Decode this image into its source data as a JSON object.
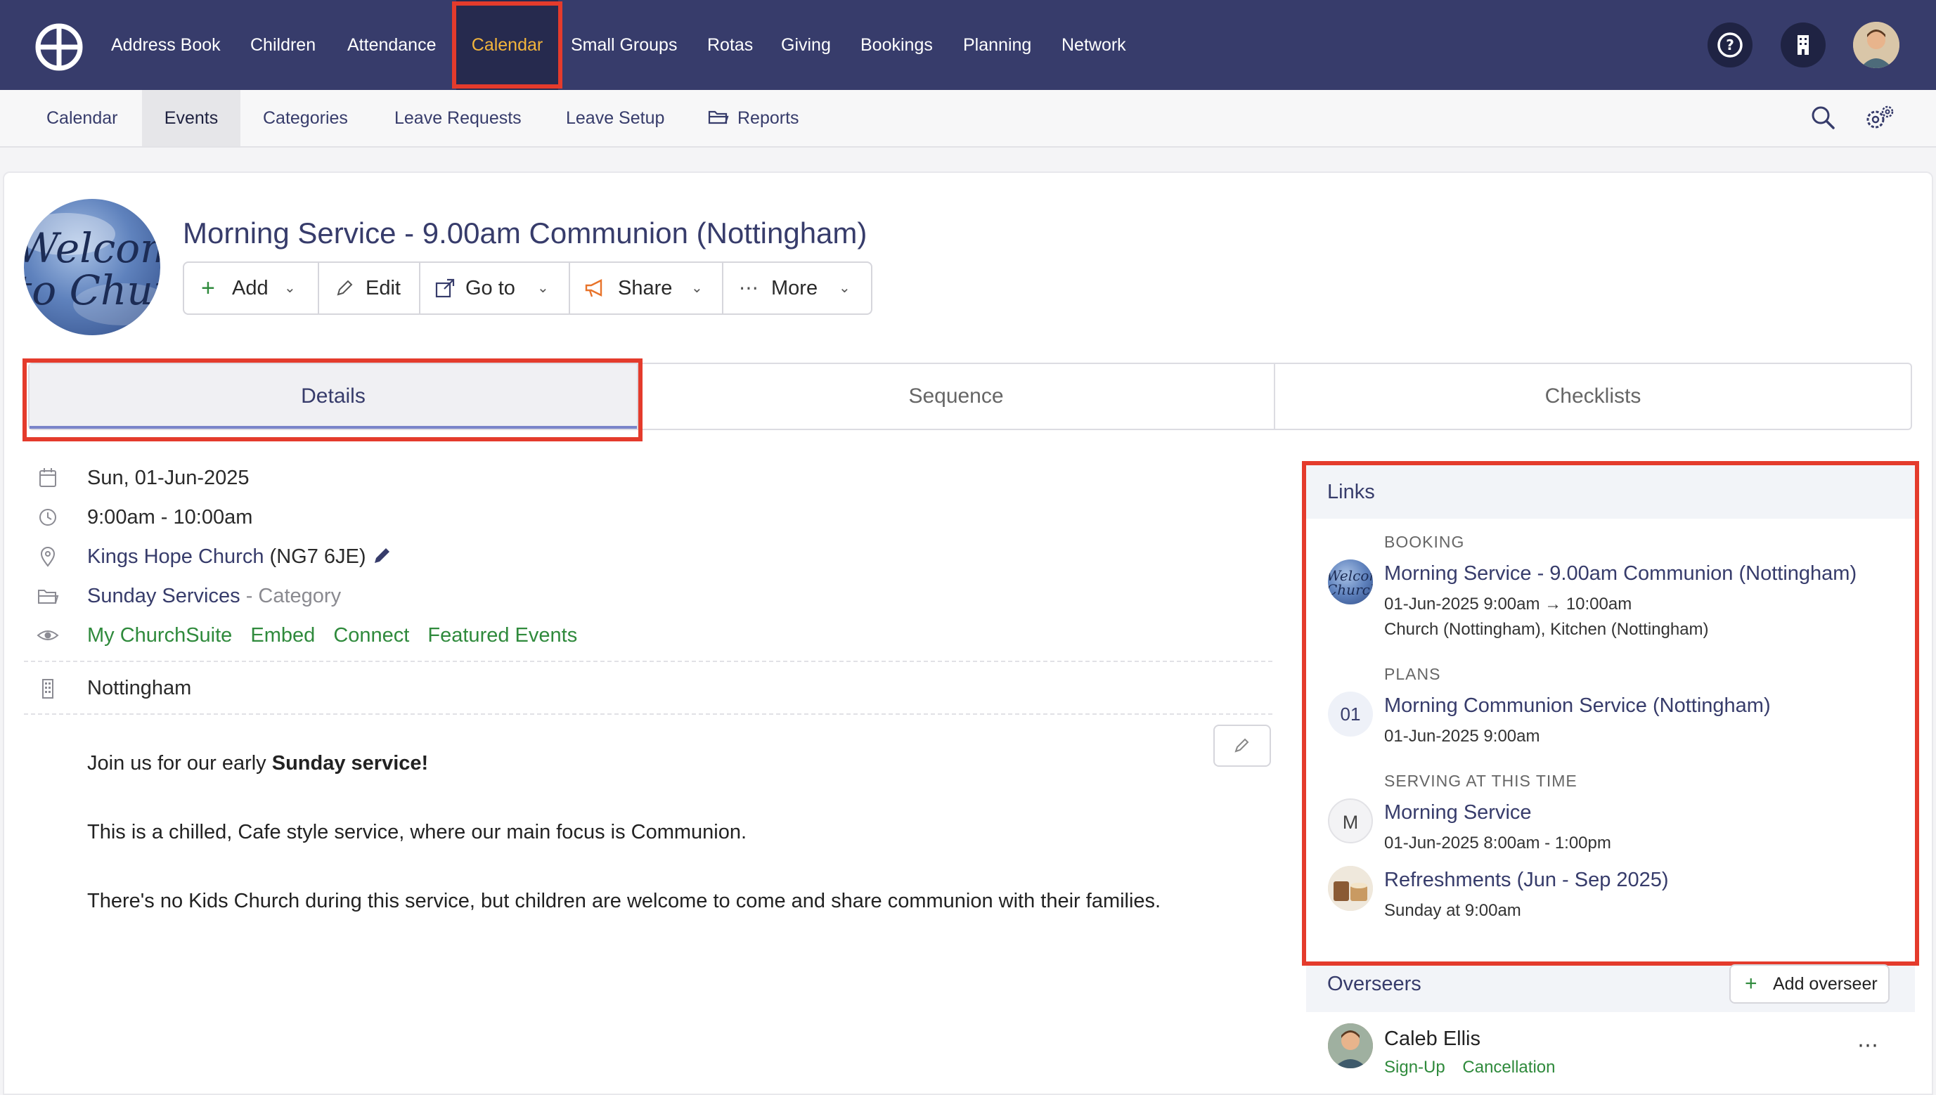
{
  "colors": {
    "nav_bg": "#373c6b",
    "accent_active": "#f3b53c",
    "highlight": "#e43b2c",
    "link_green": "#2f8a3c"
  },
  "topnav": {
    "items": [
      {
        "label": "Address Book"
      },
      {
        "label": "Children"
      },
      {
        "label": "Attendance"
      },
      {
        "label": "Calendar",
        "active": true
      },
      {
        "label": "Small Groups"
      },
      {
        "label": "Rotas"
      },
      {
        "label": "Giving"
      },
      {
        "label": "Bookings"
      },
      {
        "label": "Planning"
      },
      {
        "label": "Network"
      }
    ],
    "icons": [
      "help-icon",
      "building-icon",
      "user-avatar"
    ]
  },
  "subnav": {
    "items": [
      {
        "label": "Calendar"
      },
      {
        "label": "Events",
        "active": true
      },
      {
        "label": "Categories"
      },
      {
        "label": "Leave Requests"
      },
      {
        "label": "Leave Setup"
      },
      {
        "label": "Reports",
        "icon": "folder-icon"
      }
    ],
    "icons": [
      "search-icon",
      "settings-gear-icon"
    ]
  },
  "event": {
    "title": "Morning Service - 9.00am Communion (Nottingham)",
    "image_text": "Welcome to Church"
  },
  "actions": {
    "add": "Add",
    "edit": "Edit",
    "goto": "Go to",
    "share": "Share",
    "more": "More"
  },
  "tabs": {
    "details": "Details",
    "sequence": "Sequence",
    "checklists": "Checklists"
  },
  "details": {
    "date": "Sun, 01-Jun-2025",
    "time": "9:00am - 10:00am",
    "location_name": "Kings Hope Church",
    "location_postcode": "(NG7 6JE)",
    "category_name": "Sunday Services",
    "category_suffix": "- Category",
    "visibility": [
      "My ChurchSuite",
      "Embed",
      "Connect",
      "Featured Events"
    ],
    "site": "Nottingham"
  },
  "description": {
    "line1_prefix": "Join us for our early ",
    "line1_bold": "Sunday service!",
    "line2": "This is a chilled, Cafe style service, where our main focus is Communion.",
    "line3": "There's no Kids Church during this service, but children are welcome to come and share communion with their families."
  },
  "links": {
    "title": "Links",
    "booking": {
      "label": "BOOKING",
      "title": "Morning Service - 9.00am Communion (Nottingham)",
      "when": "01-Jun-2025 9:00am → 10:00am",
      "resources": "Church (Nottingham), Kitchen (Nottingham)"
    },
    "plans": {
      "label": "PLANS",
      "badge": "01",
      "title": "Morning Communion Service (Nottingham)",
      "when": "01-Jun-2025 9:00am"
    },
    "serving": {
      "label": "SERVING AT THIS TIME",
      "items": [
        {
          "badge": "M",
          "title": "Morning Service",
          "when": "01-Jun-2025 8:00am - 1:00pm"
        },
        {
          "badge": "",
          "title": "Refreshments (Jun - Sep 2025)",
          "when": "Sunday at 9:00am"
        }
      ]
    }
  },
  "overseers": {
    "title": "Overseers",
    "add_label": "Add overseer",
    "people": [
      {
        "name": "Caleb Ellis",
        "actions": [
          "Sign-Up",
          "Cancellation"
        ]
      }
    ]
  }
}
